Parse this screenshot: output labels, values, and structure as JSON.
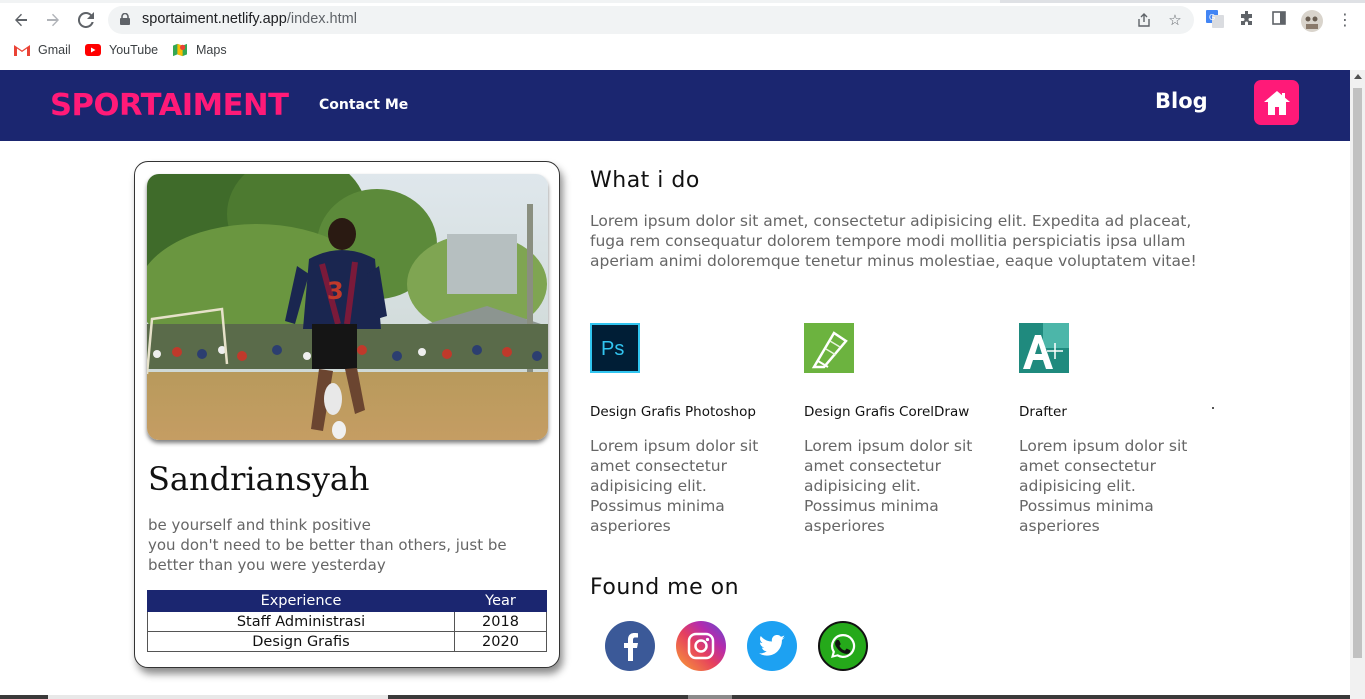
{
  "browser": {
    "url_domain": "sportaiment.netlify.app",
    "url_path": "/index.html",
    "bookmarks": [
      {
        "label": "Gmail",
        "icon": "gmail-icon"
      },
      {
        "label": "YouTube",
        "icon": "youtube-icon"
      },
      {
        "label": "Maps",
        "icon": "maps-icon"
      }
    ]
  },
  "header": {
    "brand": "SPORTAIMENT",
    "contact_label": "Contact Me",
    "blog_label": "Blog",
    "home_icon": "home-icon",
    "brand_color": "#ff1a78",
    "bar_color": "#1b2670"
  },
  "profile": {
    "name": "Sandriansyah",
    "bio_line1": "be yourself and think positive",
    "bio_line2": "you don't need to be better than others, just be better than you were yesterday",
    "table": {
      "headers": [
        "Experience",
        "Year"
      ],
      "rows": [
        [
          "Staff Administrasi",
          "2018"
        ],
        [
          "Design Grafis",
          "2020"
        ]
      ]
    }
  },
  "main": {
    "what_title": "What i do",
    "intro": "Lorem ipsum dolor sit amet, consectetur adipisicing elit. Expedita ad placeat, fuga rem consequatur dolorem tempore modi mollitia perspiciatis ipsa ullam aperiam animi doloremque tenetur minus molestiae, eaque voluptatem vitae!",
    "skills": [
      {
        "title": "Design Grafis Photoshop",
        "desc": "Lorem ipsum dolor sit amet consectetur adipisicing elit. Possimus minima asperiores",
        "icon": "photoshop-icon"
      },
      {
        "title": "Design Grafis CorelDraw",
        "desc": "Lorem ipsum dolor sit amet consectetur adipisicing elit. Possimus minima asperiores",
        "icon": "coreldraw-icon"
      },
      {
        "title": "Drafter",
        "desc": "Lorem ipsum dolor sit amet consectetur adipisicing elit. Possimus minima asperiores",
        "icon": "autocad-icon"
      }
    ],
    "found_title": "Found me on",
    "socials": [
      "facebook-icon",
      "instagram-icon",
      "twitter-icon",
      "whatsapp-icon"
    ]
  }
}
